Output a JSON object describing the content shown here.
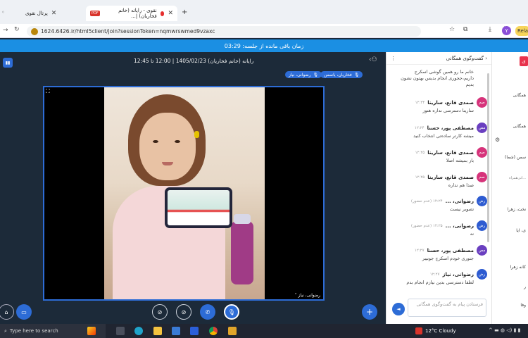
{
  "browser": {
    "tabs": [
      {
        "label": "پرتال نقوی"
      },
      {
        "label": "نقوی - رایانه (خانم فخاریان) |..."
      }
    ],
    "pdf_badge": "PDF",
    "new_tab": "+",
    "url": "1624.6426.ir/html5client/join?sessionToken=nqmwrswmed9vzaxc",
    "profile_letter": "Y",
    "rela_label": "Rela"
  },
  "session": {
    "timer_text": "زمان باقی مانده از جلسه: 03:29"
  },
  "stage": {
    "title": "رایانه (خانم فخاریان) 1405/02/23 | 12:00 تا 12:45",
    "talkers": [
      "فخاریان، یاسمن",
      "رضوانی، نیاز"
    ],
    "video_label": "رضوانی، نیاز"
  },
  "chat": {
    "header": "گفت‌وگوی همگانی",
    "messages": [
      {
        "initials": "",
        "name": "",
        "time": "",
        "text": "خانم ما رو همین گوشی اسکرج داریم،ججوری انجام بدیس بهتون نشون بدیم",
        "color": "#6a3fc0"
      },
      {
        "initials": "صم",
        "name": "صمدی قانع، سارینا",
        "time": "۱۲:۲۴",
        "text": "سارینا دسترسی نداره هنوز",
        "color": "#d6337a"
      },
      {
        "initials": "مص",
        "name": "مصطفی پور، حسنا",
        "time": "۱۲:۲۴",
        "text": "میشه کارتر ساده‌تی انتخاب کنید",
        "color": "#6a3fc0"
      },
      {
        "initials": "صم",
        "name": "صمدی قانع، سارینا",
        "time": "۱۲:۲۵",
        "text": "باز بمیشه اصلا",
        "color": "#d6337a"
      },
      {
        "initials": "صم",
        "name": "صمدی قانع، سارینا",
        "time": "۱۲:۲۵",
        "text": "صدا هم نداره",
        "color": "#d6337a"
      },
      {
        "initials": "رض",
        "name": "رضوانی، ...",
        "time": "۱۲:۲۴ (عدم حضور)",
        "text": "تصویر نیست",
        "color": "#2d5bd1"
      },
      {
        "initials": "رض",
        "name": "رضوانی، ...",
        "time": "۱۲:۲۵ (عدم حضور)",
        "text": "نه",
        "color": "#2d5bd1"
      },
      {
        "initials": "مص",
        "name": "مصطفی پور، حسنا",
        "time": "۱۲:۲۷",
        "text": "جتوری خودم اسکرج جونیبر",
        "color": "#6a3fc0"
      },
      {
        "initials": "رض",
        "name": "رضوانی، نیاز",
        "time": "۱۲:۲۷",
        "text": "لطفا دسترسی بدین نیازم انجام بدم",
        "color": "#2d5bd1"
      }
    ],
    "input_placeholder": "فرستادن پیام به گفت‌وگوی همگانی"
  },
  "users": {
    "items": [
      "همگانی",
      "همگانی",
      "سمن (شما)",
      "...اتی‌همراه",
      "نخت، زهرا",
      "ی، ایا",
      "کانه زهرا",
      "ر",
      "وفا"
    ]
  },
  "taskbar": {
    "search_placeholder": "Type here to search",
    "weather": "12°C  Cloudy"
  },
  "colors": {
    "accent": "#1b8fe3",
    "stage_bg": "#1c2a39",
    "brand_blue": "#2d6cd6"
  }
}
